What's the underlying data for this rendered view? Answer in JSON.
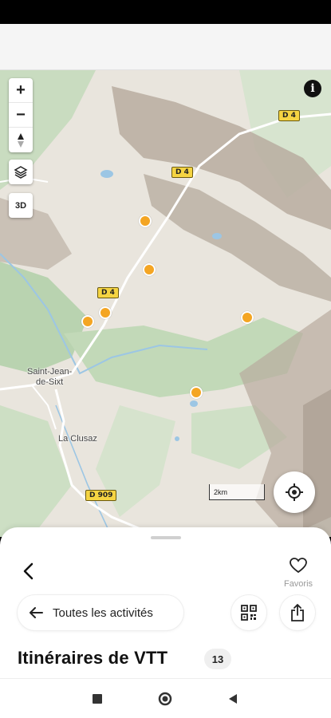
{
  "map": {
    "controls": {
      "zoom_in": "+",
      "zoom_out": "−",
      "mode_3d": "3D"
    },
    "info_label": "i",
    "road_labels": [
      "D 4",
      "D 4",
      "D 4",
      "D 909"
    ],
    "towns": [
      "Saint-Jean-de-Sixt",
      "La Clusaz"
    ],
    "town_lines": {
      "sjs1": "Saint-Jean-",
      "sjs2": "de-Sixt"
    },
    "scale_label": "2km",
    "poi_color": "#f4a523",
    "poi_count_visible": 7
  },
  "sheet": {
    "favorites_label": "Favoris",
    "all_activities_label": "Toutes les activités",
    "title": "Itinéraires de VTT",
    "count": "13"
  },
  "icons": {
    "compass": "compass-icon",
    "layers": "layers-icon",
    "locate": "crosshair-icon",
    "back": "chevron-left-icon",
    "heart": "heart-icon",
    "arrow_left": "arrow-left-icon",
    "qr": "qr-code-icon",
    "share": "share-icon"
  },
  "colors": {
    "accent": "#f4a523",
    "road": "#f5d442"
  }
}
